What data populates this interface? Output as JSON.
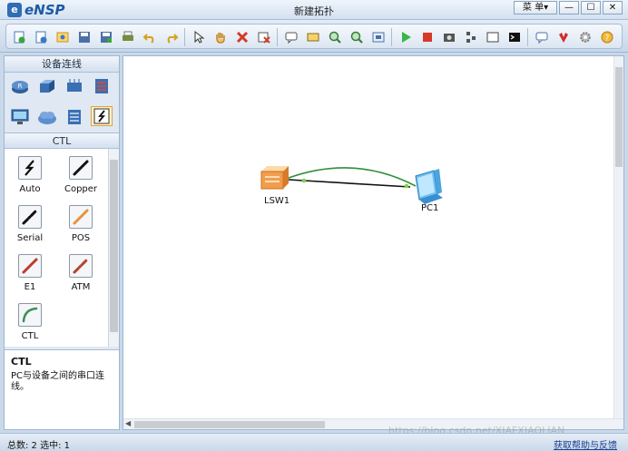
{
  "app": {
    "logo": "eNSP",
    "title": "新建拓扑",
    "menu_label": "菜 单▾"
  },
  "window_controls": {
    "minimize": "—",
    "maximize": "☐",
    "close": "✕"
  },
  "toolbar": {
    "tools": [
      "new-topology",
      "open-topology",
      "open-example",
      "save",
      "save-as",
      "print",
      "undo",
      "redo",
      "select",
      "pan",
      "delete",
      "delete-all-links",
      "text",
      "rectangle",
      "zoom-in",
      "zoom-out",
      "fit-topology",
      "start-device",
      "stop-device",
      "capture",
      "layout",
      "show-interface",
      "console",
      "topology-grid",
      "help-forum",
      "huawei-website",
      "settings",
      "feedback"
    ]
  },
  "left_panel": {
    "header": "设备连线",
    "categories": [
      "router",
      "switch",
      "wireless",
      "firewall",
      "terminal",
      "cloud",
      "other",
      "connection"
    ],
    "selected_category": "CTL",
    "devices": [
      {
        "label": "Auto",
        "icon": "auto-link-icon",
        "color": "#222222"
      },
      {
        "label": "Copper",
        "icon": "copper-link-icon",
        "color": "#1a1a1a"
      },
      {
        "label": "Serial",
        "icon": "serial-link-icon",
        "color": "#1a1a1a"
      },
      {
        "label": "POS",
        "icon": "pos-link-icon",
        "color": "#e8923a"
      },
      {
        "label": "E1",
        "icon": "e1-link-icon",
        "color": "#c0392b"
      },
      {
        "label": "ATM",
        "icon": "atm-link-icon",
        "color": "#b5432a"
      },
      {
        "label": "CTL",
        "icon": "ctl-link-icon",
        "color": "#3d8f55"
      }
    ],
    "description": {
      "title": "CTL",
      "text": "PC与设备之间的串口连线。"
    }
  },
  "canvas": {
    "nodes": [
      {
        "label": "LSW1",
        "type": "switch"
      },
      {
        "label": "PC1",
        "type": "pc"
      }
    ],
    "links": [
      {
        "type": "copper",
        "color": "#111111"
      },
      {
        "type": "ctl",
        "color": "#2f8f3a"
      }
    ]
  },
  "status": {
    "total": "总数: 2  选中: 1",
    "help_link": "获取帮助与反馈"
  },
  "watermark": "https://blog.csdn.net/XIAFXIAOLIAN"
}
